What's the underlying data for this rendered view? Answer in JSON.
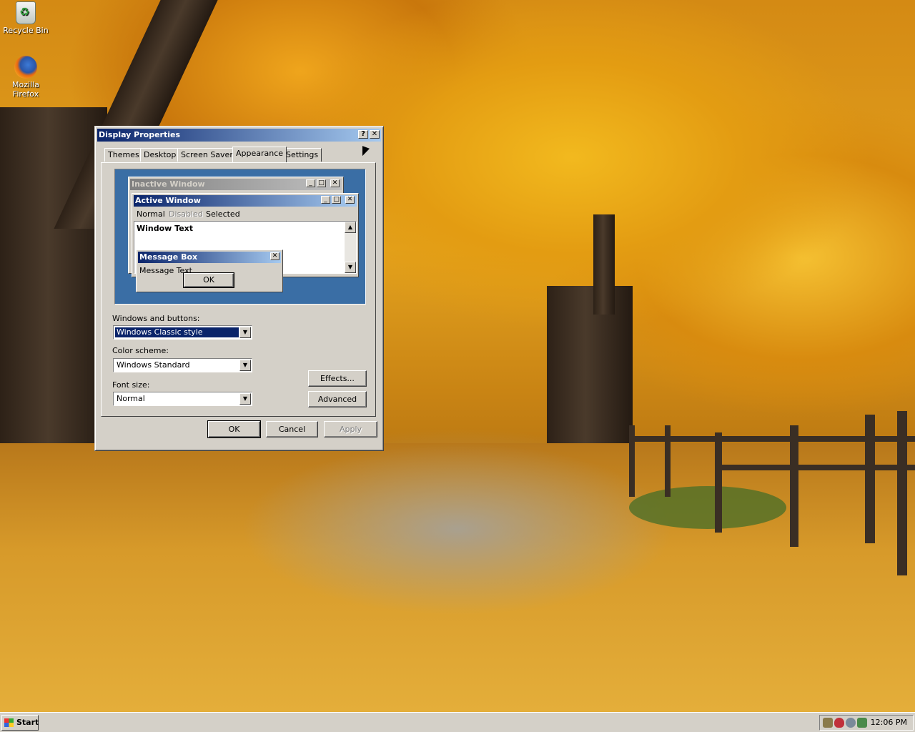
{
  "desktop": {
    "icons": [
      {
        "label": "Recycle Bin",
        "icon": "recycle-bin-icon"
      },
      {
        "label": "Mozilla Firefox",
        "icon": "firefox-icon"
      }
    ]
  },
  "dialog": {
    "title": "Display Properties",
    "help_symbol": "?",
    "close_symbol": "✕",
    "tabs": [
      {
        "label": "Themes"
      },
      {
        "label": "Desktop"
      },
      {
        "label": "Screen Saver"
      },
      {
        "label": "Appearance",
        "active": true
      },
      {
        "label": "Settings"
      }
    ],
    "preview": {
      "inactive_window_title": "Inactive Window",
      "active_window_title": "Active Window",
      "menu_normal": "Normal",
      "menu_disabled": "Disabled",
      "menu_selected": "Selected",
      "window_text": "Window Text",
      "message_box_title": "Message Box",
      "message_text": "Message Text",
      "ok_label": "OK"
    },
    "windows_and_buttons": {
      "label": "Windows and buttons:",
      "value": "Windows Classic style"
    },
    "color_scheme": {
      "label": "Color scheme:",
      "value": "Windows Standard"
    },
    "font_size": {
      "label": "Font size:",
      "value": "Normal"
    },
    "effects_label": "Effects...",
    "advanced_label": "Advanced",
    "ok_label": "OK",
    "cancel_label": "Cancel",
    "apply_label": "Apply"
  },
  "taskbar": {
    "start_label": "Start",
    "clock": "12:06 PM"
  },
  "colors": {
    "title_active_start": "#0a246a",
    "title_active_end": "#a6caf0",
    "title_inactive_start": "#808080",
    "title_inactive_end": "#c0c0c0",
    "face": "#d4d0c8",
    "preview_desktop": "#3a6ea5"
  }
}
